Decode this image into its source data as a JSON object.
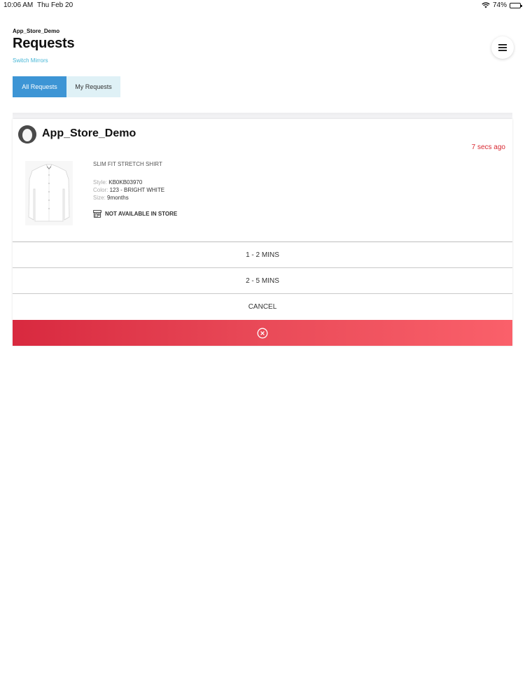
{
  "status_bar": {
    "time": "10:06 AM",
    "date": "Thu Feb 20",
    "battery": "74%",
    "battery_level": 0.74
  },
  "header": {
    "org": "App_Store_Demo",
    "title": "Requests",
    "switch_label": "Switch Mirrors"
  },
  "tabs": [
    {
      "label": "All Requests",
      "active": true
    },
    {
      "label": "My Requests",
      "active": false
    }
  ],
  "request": {
    "user": "App_Store_Demo",
    "time_ago": "7 secs ago",
    "product": {
      "name": "SLIM FIT STRETCH SHIRT",
      "style_label": "Style:",
      "style": "KB0KB03970",
      "color_label": "Color:",
      "color": "123 - BRIGHT WHITE",
      "size_label": "Size:",
      "size": "9months",
      "availability": "NOT AVAILABLE IN STORE"
    },
    "actions": [
      "1 - 2 MINS",
      "2 - 5 MINS",
      "CANCEL"
    ]
  },
  "colors": {
    "accent": "#3d95d5",
    "tab_inactive": "#dff1f6",
    "link": "#45b6d6",
    "alert": "#d82a33"
  },
  "icons": {
    "menu": "hamburger-icon",
    "dismiss": "close-circle-icon",
    "store": "store-icon",
    "wifi": "wifi-icon",
    "battery": "battery-icon"
  }
}
